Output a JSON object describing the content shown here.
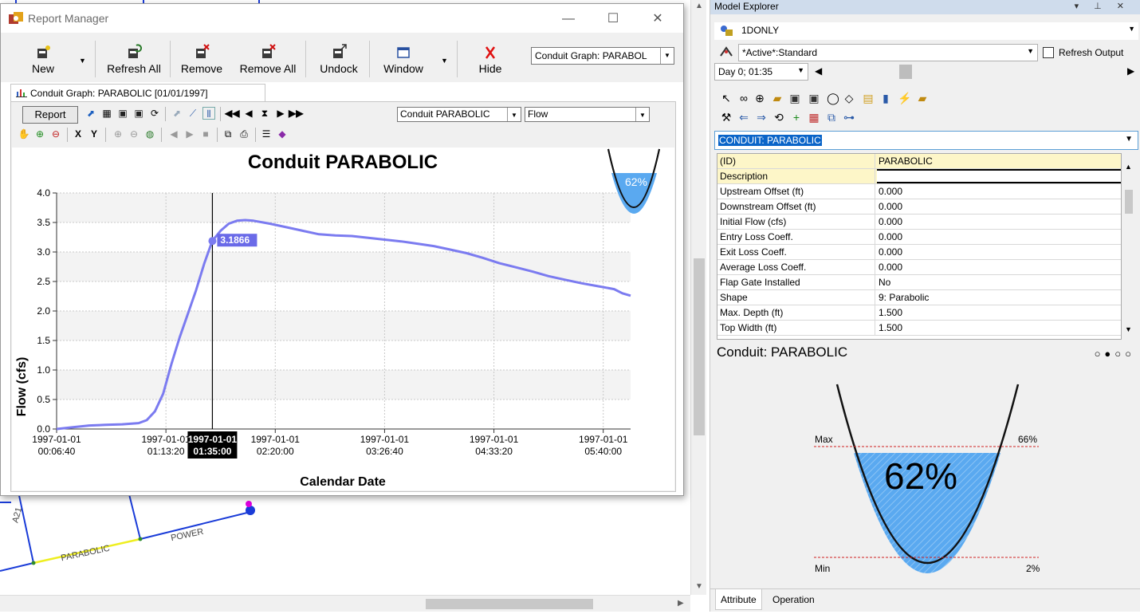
{
  "report_window": {
    "title": "Report Manager",
    "toolbar": {
      "new": "New",
      "refresh_all": "Refresh All",
      "remove": "Remove",
      "remove_all": "Remove All",
      "undock": "Undock",
      "window": "Window",
      "hide": "Hide",
      "report_select": "Conduit Graph: PARABOL"
    },
    "tab_label": "Conduit Graph: PARABOLIC [01/01/1997]",
    "graph_toolbar": {
      "report_button": "Report",
      "element_combo": "Conduit PARABOLIC",
      "variable_combo": "Flow"
    }
  },
  "chart_data": {
    "type": "line",
    "title": "Conduit PARABOLIC",
    "xlabel": "Calendar Date",
    "ylabel": "Flow (cfs)",
    "ylim": [
      0,
      4.0
    ],
    "yticks": [
      "0.0",
      "0.5",
      "1.0",
      "1.5",
      "2.0",
      "2.5",
      "3.0",
      "3.5",
      "4.0"
    ],
    "xticks": [
      {
        "date": "1997-01-01",
        "time": "00:06:40"
      },
      {
        "date": "1997-01-01",
        "time": "01:13:20"
      },
      {
        "date": "1997-01-01",
        "time": "02:20:00"
      },
      {
        "date": "1997-01-01",
        "time": "03:26:40"
      },
      {
        "date": "1997-01-01",
        "time": "04:33:20"
      },
      {
        "date": "1997-01-01",
        "time": "05:40:00"
      }
    ],
    "series": [
      {
        "color": "#7b7bf0",
        "x_minutes": [
          0,
          10,
          20,
          30,
          40,
          50,
          55,
          60,
          65,
          70,
          75,
          80,
          85,
          90,
          95,
          100,
          105,
          110,
          115,
          120,
          130,
          140,
          150,
          160,
          170,
          180,
          190,
          200,
          210,
          220,
          230,
          240,
          250,
          260,
          270,
          280,
          290,
          300,
          310,
          320,
          330,
          340,
          345,
          350
        ],
        "values": [
          0.0,
          0.03,
          0.06,
          0.07,
          0.08,
          0.1,
          0.15,
          0.3,
          0.6,
          1.1,
          1.55,
          1.95,
          2.35,
          2.8,
          3.19,
          3.36,
          3.48,
          3.53,
          3.54,
          3.53,
          3.48,
          3.42,
          3.36,
          3.3,
          3.28,
          3.27,
          3.24,
          3.21,
          3.18,
          3.14,
          3.1,
          3.04,
          2.98,
          2.9,
          2.81,
          2.74,
          2.67,
          2.59,
          2.53,
          2.47,
          2.42,
          2.37,
          2.3,
          2.26
        ]
      }
    ],
    "cursor": {
      "x_minutes": 95,
      "date": "1997-01-01",
      "time": "01:35:00",
      "value_label": "3.1866"
    },
    "gauge_percent": "62%"
  },
  "explorer": {
    "title": "Model Explorer",
    "project": "1DONLY",
    "scenario": "*Active*:Standard",
    "refresh_output": "Refresh Output",
    "time": "Day 0;  01:35",
    "selected_object": "CONDUIT: PARABOLIC",
    "properties": [
      {
        "name": "(ID)",
        "value": "PARABOLIC"
      },
      {
        "name": "Description",
        "value": ""
      },
      {
        "name": "Upstream Offset (ft)",
        "value": "0.000"
      },
      {
        "name": "Downstream Offset (ft)",
        "value": "0.000"
      },
      {
        "name": "Initial Flow (cfs)",
        "value": "0.000"
      },
      {
        "name": "Entry Loss Coeff.",
        "value": "0.000"
      },
      {
        "name": "Exit Loss Coeff.",
        "value": "0.000"
      },
      {
        "name": "Average Loss Coeff.",
        "value": "0.000"
      },
      {
        "name": "Flap Gate Installed",
        "value": "No"
      },
      {
        "name": "Shape",
        "value": "9: Parabolic"
      },
      {
        "name": "Max. Depth (ft)",
        "value": "1.500"
      },
      {
        "name": "Top Width (ft)",
        "value": "1.500"
      }
    ],
    "section_title": "Conduit: PARABOLIC",
    "graphic": {
      "max_label": "Max",
      "max_value": "66%",
      "min_label": "Min",
      "min_value": "2%",
      "fill_percent": "62%"
    },
    "tabs": [
      "Attribute",
      "Operation"
    ]
  },
  "map_labels": [
    "A21",
    "POWER",
    "PARABOLIC"
  ],
  "colors": {
    "series": "#7b7bf0",
    "water": "#5aa9f0",
    "highlight": "#0a64c8",
    "explorer_title": "#cfdcec",
    "conduit_highlight": "#f0f000"
  }
}
